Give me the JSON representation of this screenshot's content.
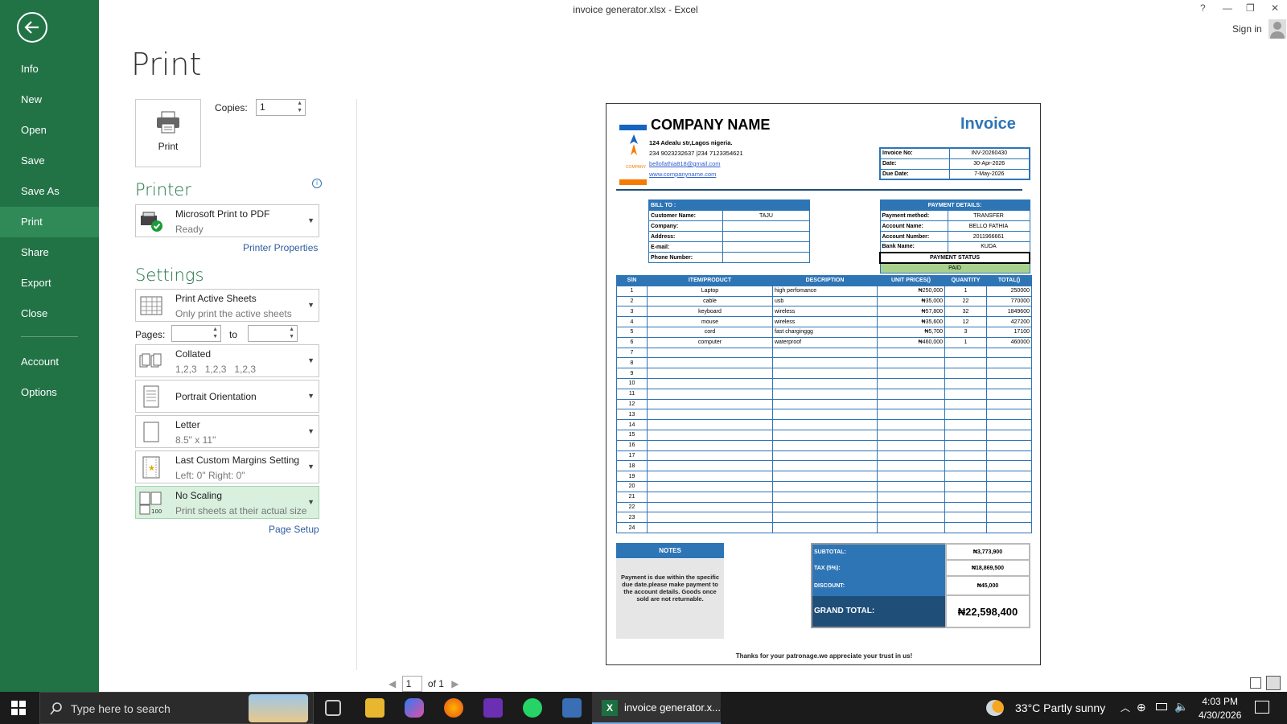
{
  "window": {
    "title": "invoice generator.xlsx - Excel",
    "help": "?",
    "minimize": "—",
    "restore": "❐",
    "close": "✕",
    "sign_in": "Sign in"
  },
  "sidebar": {
    "items": [
      "Info",
      "New",
      "Open",
      "Save",
      "Save As",
      "Print",
      "Share",
      "Export",
      "Close",
      "Account",
      "Options"
    ],
    "active": "Print"
  },
  "print": {
    "heading": "Print",
    "print_button": "Print",
    "copies_label": "Copies:",
    "copies_value": "1",
    "printer_heading": "Printer",
    "printer_name": "Microsoft Print to PDF",
    "printer_status": "Ready",
    "printer_properties": "Printer Properties",
    "settings_heading": "Settings",
    "active_sheets": "Print Active Sheets",
    "active_sheets_sub": "Only print the active sheets",
    "pages_label": "Pages:",
    "to_label": "to",
    "collated": "Collated",
    "collated_sub": [
      "1,2,3",
      "1,2,3",
      "1,2,3"
    ],
    "orientation": "Portrait Orientation",
    "paper": "Letter",
    "paper_sub": "8.5\" x 11\"",
    "margins": "Last Custom Margins Setting",
    "margins_sub": "Left:  0\"    Right:  0\"",
    "scaling": "No Scaling",
    "scaling_sub": "Print sheets at their actual size",
    "scaling_icon_text": "100",
    "page_setup": "Page Setup",
    "page_current": "1",
    "page_of": "of 1"
  },
  "invoice": {
    "company_name": "COMPANY NAME",
    "logo_text": "COMPANY",
    "title": "Invoice",
    "address": "124 Adealu str,Lagos nigeria.",
    "phone": "234 9023232637 |234 7123354621",
    "email": "bellofathia818@gmail.com",
    "website": "www.companyname.com",
    "meta": [
      [
        "Invoice No:",
        "INV-20260430"
      ],
      [
        "Date:",
        "30-Apr-2026"
      ],
      [
        "Due Date:",
        "7-May-2026"
      ]
    ],
    "bill_to_heading": "BILL TO :",
    "bill_to": [
      [
        "Customer Name:",
        "TAJU"
      ],
      [
        "Company:",
        ""
      ],
      [
        "Address:",
        ""
      ],
      [
        "E-mail:",
        ""
      ],
      [
        "Phone Number:",
        ""
      ]
    ],
    "payment_heading": "PAYMENT DETAILS:",
    "payment": [
      [
        "Payment method:",
        "TRANSFER"
      ],
      [
        "Account Name:",
        "BELLO FATHIA"
      ],
      [
        "Account Number:",
        "2011966661"
      ],
      [
        "Bank Name:",
        "KUDA"
      ]
    ],
    "payment_status_label": "PAYMENT STATUS",
    "payment_status": "PAID",
    "columns": [
      "S\\N",
      "ITEM/PRODUCT",
      "DESCRIPTION",
      "UNIT PRICES()",
      "QUANTITY",
      "TOTAL()"
    ],
    "rows": [
      [
        "1",
        "Laptop",
        "high perfomance",
        "₦250,000",
        "1",
        "250000"
      ],
      [
        "2",
        "cable",
        "usb",
        "₦35,000",
        "22",
        "770000"
      ],
      [
        "3",
        "keyboard",
        "wireless",
        "₦57,800",
        "32",
        "1849600"
      ],
      [
        "4",
        "mouse",
        "wireless",
        "₦35,600",
        "12",
        "427200"
      ],
      [
        "5",
        "cord",
        "fast charginggg",
        "₦5,700",
        "3",
        "17100"
      ],
      [
        "6",
        "computer",
        "waterproof",
        "₦460,000",
        "1",
        "460000"
      ],
      [
        "7",
        "",
        "",
        "",
        "",
        ""
      ],
      [
        "8",
        "",
        "",
        "",
        "",
        ""
      ],
      [
        "9",
        "",
        "",
        "",
        "",
        ""
      ],
      [
        "10",
        "",
        "",
        "",
        "",
        ""
      ],
      [
        "11",
        "",
        "",
        "",
        "",
        ""
      ],
      [
        "12",
        "",
        "",
        "",
        "",
        ""
      ],
      [
        "13",
        "",
        "",
        "",
        "",
        ""
      ],
      [
        "14",
        "",
        "",
        "",
        "",
        ""
      ],
      [
        "15",
        "",
        "",
        "",
        "",
        ""
      ],
      [
        "16",
        "",
        "",
        "",
        "",
        ""
      ],
      [
        "17",
        "",
        "",
        "",
        "",
        ""
      ],
      [
        "18",
        "",
        "",
        "",
        "",
        ""
      ],
      [
        "19",
        "",
        "",
        "",
        "",
        ""
      ],
      [
        "20",
        "",
        "",
        "",
        "",
        ""
      ],
      [
        "21",
        "",
        "",
        "",
        "",
        ""
      ],
      [
        "22",
        "",
        "",
        "",
        "",
        ""
      ],
      [
        "23",
        "",
        "",
        "",
        "",
        ""
      ],
      [
        "24",
        "",
        "",
        "",
        "",
        ""
      ]
    ],
    "notes_heading": "NOTES",
    "notes": "Payment is due within the specific due date.please make payment to the account details. Goods once sold are not returnable.",
    "totals": [
      [
        "SUBTOTAL:",
        "₦3,773,900"
      ],
      [
        "TAX (5%):",
        "₦18,869,500"
      ],
      [
        "DISCOUNT:",
        "₦45,000"
      ]
    ],
    "grand_total_label": "GRAND TOTAL:",
    "grand_total": "₦22,598,400",
    "thanks": "Thanks for your patronage.we appreciate your trust in us!"
  },
  "taskbar": {
    "search_placeholder": "Type here to search",
    "excel_task": "invoice generator.x...",
    "weather": "33°C  Partly sunny",
    "time": "4:03 PM",
    "date": "4/30/2026"
  },
  "colors": {
    "excel_green": "#217346",
    "invoice_blue": "#2e75b6",
    "paid_green": "#a9d18e"
  }
}
